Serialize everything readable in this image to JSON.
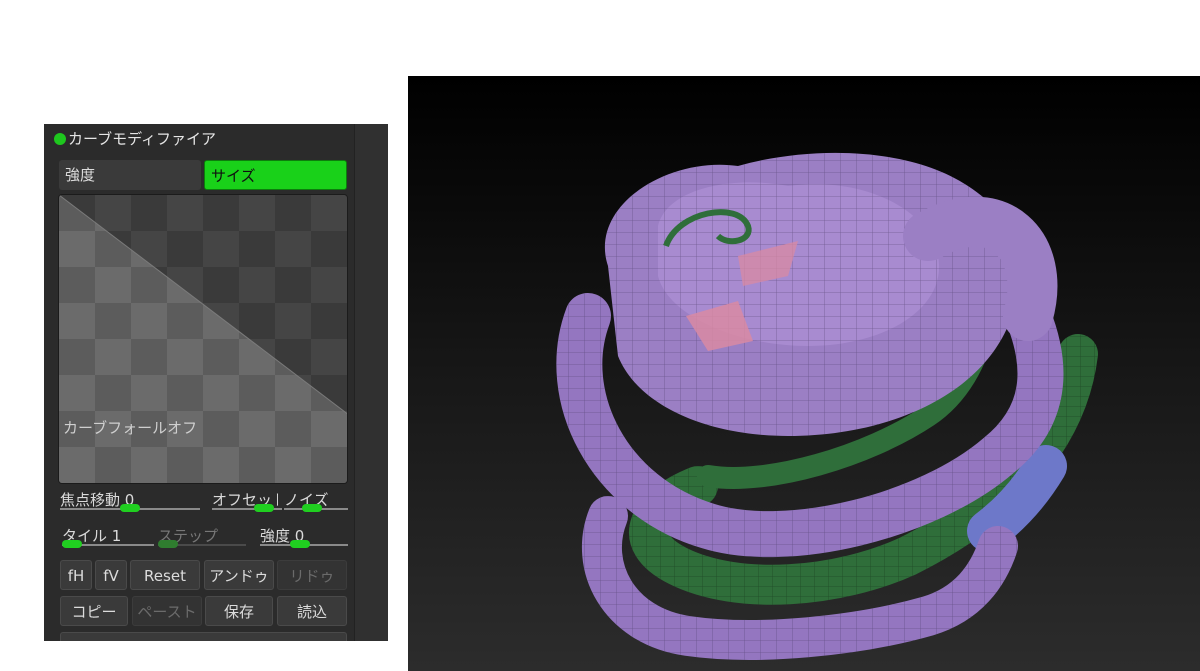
{
  "panel": {
    "title": "カーブモディファイア",
    "tabs": {
      "strength": "強度",
      "size": "サイズ"
    },
    "curve_label": "カーブフォールオフ",
    "sliders": {
      "focal_shift": {
        "label": "焦点移動 0",
        "value": 0
      },
      "offset": {
        "label": "オフセット"
      },
      "noise": {
        "label": "ノイズ"
      },
      "tile": {
        "label": "タイル 1",
        "value": 1
      },
      "step": {
        "label": "ステップ"
      },
      "strength": {
        "label": "強度 0",
        "value": 0
      }
    },
    "buttons": {
      "fh": "fH",
      "fv": "fV",
      "reset": "Reset",
      "undo": "アンドゥ",
      "redo": "リドゥ",
      "copy": "コピー",
      "paste": "ペースト",
      "save": "保存",
      "load": "読込"
    }
  },
  "colors": {
    "accent_green": "#19d119",
    "panel_bg": "#2b2b2b",
    "mesh_purple": "#9b7fc4",
    "mesh_green": "#2f6e3a",
    "mesh_blue": "#6d78c9",
    "mesh_pink": "#d98aa3"
  }
}
